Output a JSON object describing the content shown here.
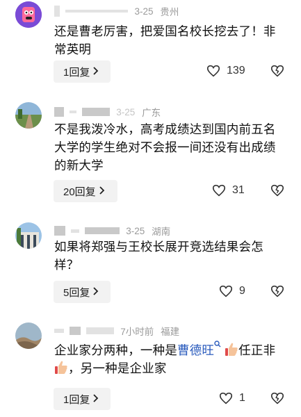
{
  "comments": [
    {
      "date": "3-25",
      "location": "贵州",
      "text": "还是曹老厉害，把爱国名校长挖去了！非常英明",
      "reply_label": "1回复",
      "likes": "139"
    },
    {
      "date": "3-25",
      "location": "广东",
      "text": "不是我泼冷水，高考成绩达到国内前五名大学的学生绝对不会报一间还没有出成绩的新大学",
      "reply_label": "20回复",
      "likes": "31"
    },
    {
      "date": "3-25",
      "location": "湖南",
      "text": "如果将郑强与王校长展开竞选结果会怎样？",
      "reply_label": "5回复",
      "likes": "9"
    },
    {
      "date": "7小时前",
      "location": "福建",
      "text_part1": "企业家分两种，一种是",
      "highlight": "曹德旺",
      "text_part2": "任正非",
      "text_part3": "，另一种是企业家",
      "reply_label": "1回复",
      "likes": "1"
    }
  ],
  "icons": {
    "like": "heart-icon",
    "dislike": "broken-heart-icon",
    "chevron": "chevron-right-icon",
    "search": "search-icon",
    "thumb": "thumbs-up-emoji"
  },
  "colors": {
    "highlight": "#2a5bbd",
    "pill_bg": "#f2f2f2",
    "meta": "#9a9a9a"
  }
}
